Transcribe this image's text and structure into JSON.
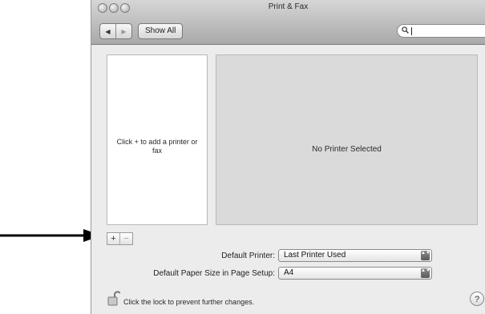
{
  "window": {
    "title": "Print & Fax"
  },
  "toolbar": {
    "back_glyph": "◀",
    "forward_glyph": "▶",
    "show_all_label": "Show All",
    "search_placeholder": ""
  },
  "printer_list": {
    "empty_message": "Click + to add a printer or fax",
    "add_glyph": "+",
    "remove_glyph": "−"
  },
  "detail": {
    "message": "No Printer Selected"
  },
  "settings": {
    "default_printer_label": "Default Printer:",
    "default_printer_value": "Last Printer Used",
    "paper_size_label": "Default Paper Size in Page Setup:",
    "paper_size_value": "A4",
    "popup_arrows": "▲▼"
  },
  "footer": {
    "lock_text": "Click the lock to prevent further changes.",
    "help_glyph": "?"
  },
  "icons": [
    "close-icon",
    "minimize-icon",
    "zoom-icon",
    "search-icon",
    "padlock-icon",
    "arrow-icon"
  ]
}
